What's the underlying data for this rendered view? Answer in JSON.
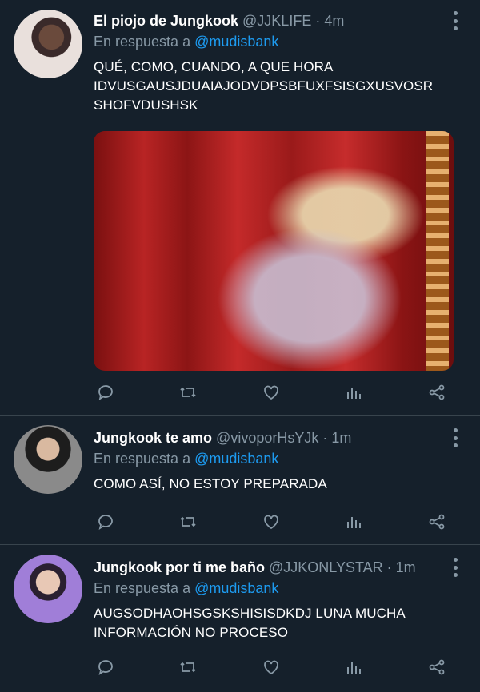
{
  "tweets": [
    {
      "name": "El piojo de Jungkook",
      "handle": "@JJKLIFE",
      "time": "4m",
      "reply_prefix": "En respuesta a",
      "reply_to": "@mudisbank",
      "text_lines": [
        "QUÉ, COMO, CUANDO, A QUE HORA",
        "IDVUSGAUSJDUAIAJODVDPSBFUXFSISGXUSVOSR",
        "SHOFVDUSHSK"
      ],
      "has_media": true
    },
    {
      "name": "Jungkook te amo",
      "handle": "@vivoporHsYJk",
      "time": "1m",
      "reply_prefix": "En respuesta a",
      "reply_to": "@mudisbank",
      "text_lines": [
        "COMO ASÍ, NO ESTOY PREPARADA"
      ],
      "has_media": false
    },
    {
      "name": "Jungkook por ti me baño",
      "handle": "@JJKONLYSTAR",
      "time": "1m",
      "reply_prefix": "En respuesta a",
      "reply_to": "@mudisbank",
      "text_lines": [
        "AUGSODHAOHSGSKSHISISDKDJ LUNA MUCHA",
        "INFORMACIÓN NO PROCESO"
      ],
      "has_media": false
    }
  ],
  "separator": " · ",
  "icons": [
    "reply-icon",
    "retweet-icon",
    "like-icon",
    "stats-icon",
    "share-icon"
  ],
  "colors": {
    "background": "#15202b",
    "secondary_text": "#8899a6",
    "mention": "#1d9bf0",
    "divider": "#38444d"
  }
}
